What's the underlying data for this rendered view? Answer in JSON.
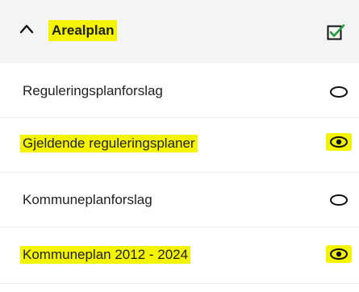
{
  "group": {
    "title": "Arealplan",
    "expand_icon": "chevron-up-icon",
    "checkbox_icon": "checkbox-checked-icon",
    "highlight_color": "#f4f400",
    "check_color": "#1e9e3c"
  },
  "layers": [
    {
      "label": "Reguleringsplanforslag",
      "visible": false,
      "highlighted": false,
      "icon": "eye-closed-icon"
    },
    {
      "label": "Gjeldende reguleringsplaner",
      "visible": true,
      "highlighted": true,
      "icon": "eye-open-icon"
    },
    {
      "label": "Kommuneplanforslag",
      "visible": false,
      "highlighted": false,
      "icon": "eye-closed-icon"
    },
    {
      "label": "Kommuneplan 2012 - 2024",
      "visible": true,
      "highlighted": true,
      "icon": "eye-open-icon"
    }
  ]
}
